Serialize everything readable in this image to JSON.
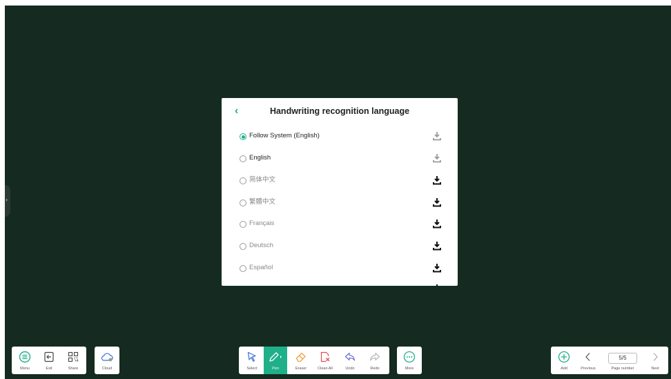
{
  "dialog": {
    "title": "Handwriting recognition language",
    "back_glyph": "‹",
    "languages": [
      {
        "label": "Follow System (English)",
        "selected": true,
        "downloaded": true
      },
      {
        "label": "English",
        "selected": false,
        "downloaded": true
      },
      {
        "label": "简体中文",
        "selected": false,
        "downloaded": false
      },
      {
        "label": "繁體中文",
        "selected": false,
        "downloaded": false
      },
      {
        "label": "Français",
        "selected": false,
        "downloaded": false
      },
      {
        "label": "Deutsch",
        "selected": false,
        "downloaded": false
      },
      {
        "label": "Español",
        "selected": false,
        "downloaded": false
      }
    ]
  },
  "toolbar_left": {
    "menu": "Menu",
    "exit": "Exit",
    "share": "Share",
    "cloud": "Cloud"
  },
  "toolbar_center": {
    "select": "Select",
    "pen": "Pen",
    "eraser": "Eraser",
    "clean_all": "Clean All",
    "undo": "Undo",
    "redo": "Redo",
    "more": "More"
  },
  "toolbar_right": {
    "add": "Add",
    "previous": "Previous",
    "page_number_value": "5/5",
    "page_number_label": "Page number",
    "next": "Next"
  },
  "colors": {
    "board": "#152a20",
    "accent": "#1fb089",
    "eraser": "#f0a040",
    "clean_all": "#e05050",
    "undo": "#6a6fd0"
  }
}
